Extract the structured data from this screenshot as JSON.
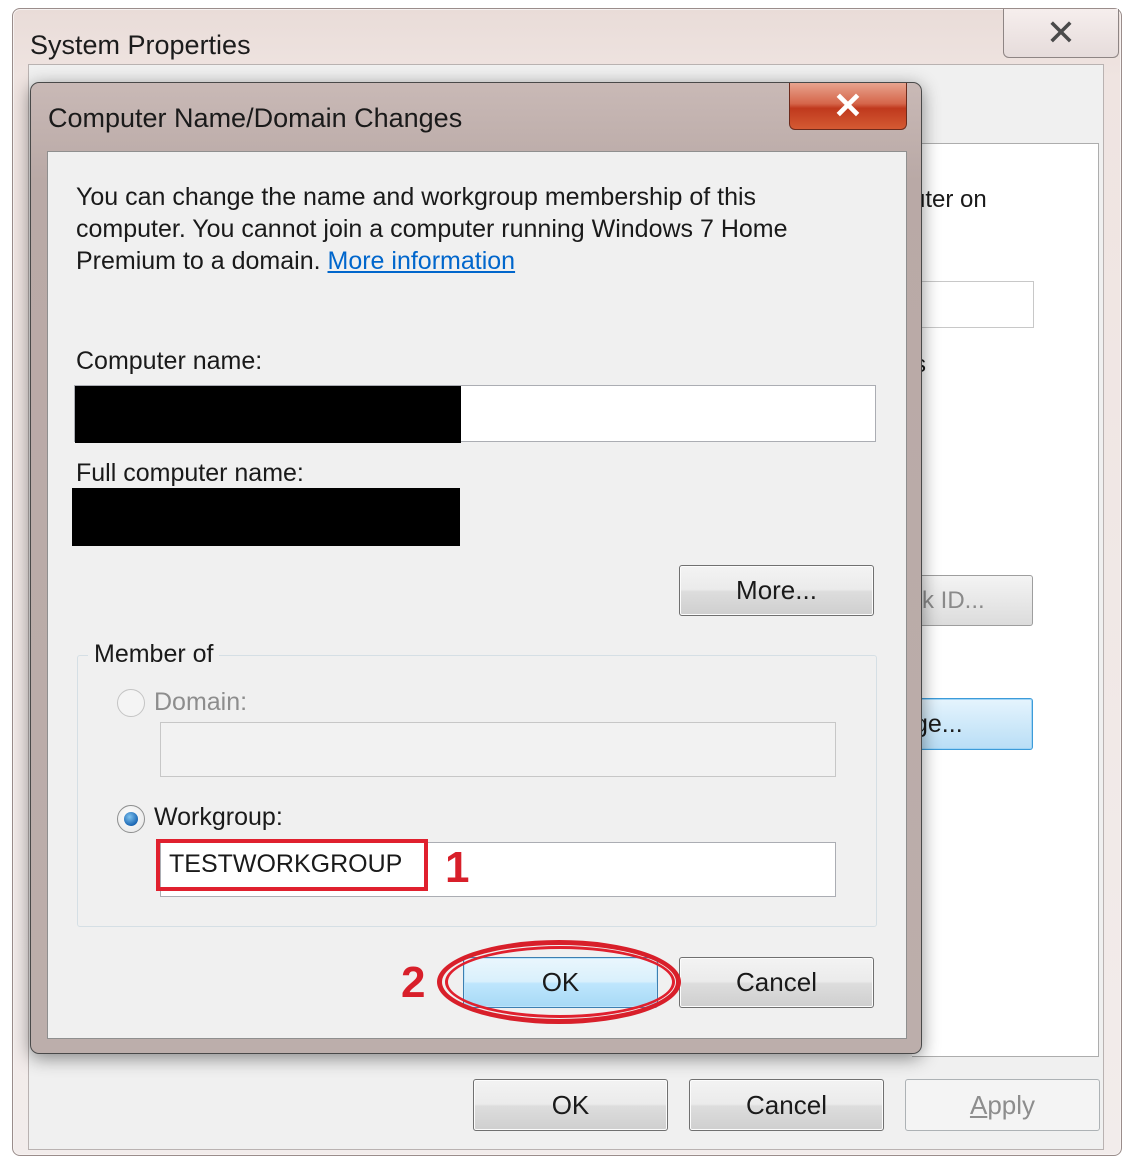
{
  "background_window": {
    "title": "System Properties",
    "close_glyph": "✕",
    "peek_text_1": "uter on",
    "peek_text_2": "s",
    "peek_button_1": "rk ID...",
    "peek_button_2": "ge...",
    "buttons": {
      "ok": "OK",
      "cancel": "Cancel",
      "apply": "Apply"
    }
  },
  "dialog": {
    "title": "Computer Name/Domain Changes",
    "close_glyph": "✕",
    "description": "You can change the name and workgroup membership of this computer. You cannot join a computer running Windows 7 Home Premium to a domain.",
    "more_info_link": "More information",
    "computer_name_label": "Computer name:",
    "full_computer_name_label": "Full computer name:",
    "more_button": "More...",
    "member_of_label": "Member of",
    "domain_label": "Domain:",
    "domain_value": "",
    "workgroup_label": "Workgroup:",
    "workgroup_value": "TESTWORKGROUP",
    "ok_button": "OK",
    "cancel_button": "Cancel"
  },
  "annotations": {
    "step1": "1",
    "step2": "2"
  },
  "colors": {
    "annotation_red": "#d81f2a",
    "link_blue": "#0066cc",
    "close_red": "#c0391d"
  }
}
